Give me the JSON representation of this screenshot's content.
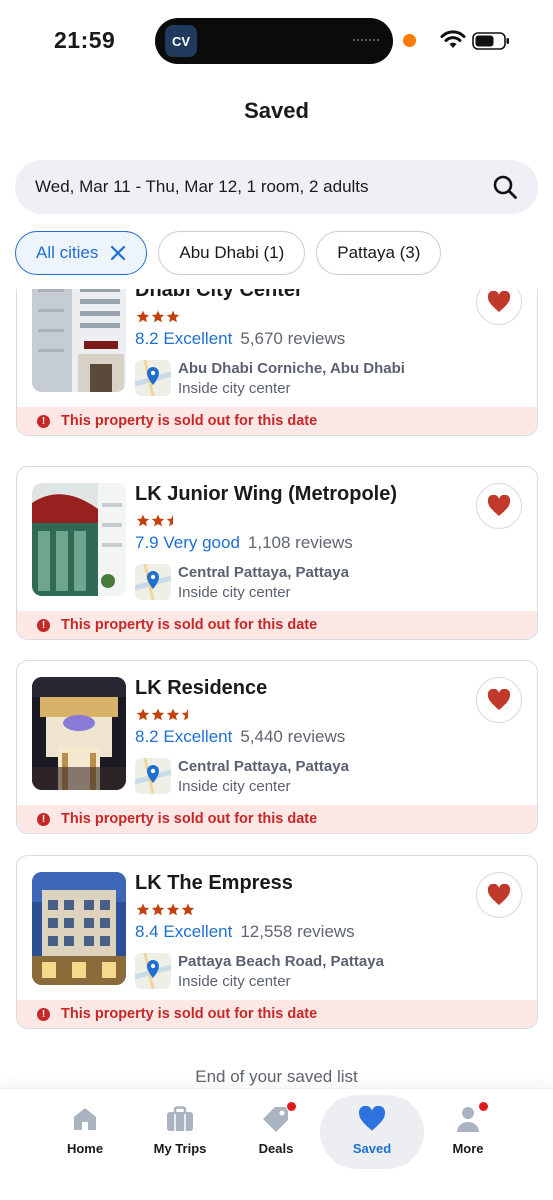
{
  "status_bar": {
    "time": "21:59",
    "island_app": "CV"
  },
  "header": {
    "title": "Saved"
  },
  "search": {
    "text": "Wed, Mar 11 - Thu, Mar 12, 1 room, 2 adults"
  },
  "filters": [
    {
      "label": "All cities",
      "active": true
    },
    {
      "label": "Abu Dhabi (1)",
      "active": false
    },
    {
      "label": "Pattaya (3)",
      "active": false
    }
  ],
  "hotels": [
    {
      "name": "Dhabi City Center",
      "stars": 3,
      "rating": "8.2 Excellent",
      "reviews": "5,670 reviews",
      "location": "Abu Dhabi Corniche, Abu Dhabi",
      "location_sub": "Inside city center",
      "status": "This property is sold out for this date"
    },
    {
      "name": "LK Junior Wing (Metropole)",
      "stars": 2.5,
      "rating": "7.9 Very good",
      "reviews": "1,108 reviews",
      "location": "Central Pattaya, Pattaya",
      "location_sub": "Inside city center",
      "status": "This property is sold out for this date"
    },
    {
      "name": "LK Residence",
      "stars": 3.5,
      "rating": "8.2 Excellent",
      "reviews": "5,440 reviews",
      "location": "Central Pattaya, Pattaya",
      "location_sub": "Inside city center",
      "status": "This property is sold out for this date"
    },
    {
      "name": "LK The Empress",
      "stars": 4,
      "rating": "8.4 Excellent",
      "reviews": "12,558 reviews",
      "location": "Pattaya Beach Road, Pattaya",
      "location_sub": "Inside city center",
      "status": "This property is sold out for this date"
    }
  ],
  "end_text": "End of your saved list",
  "tabs": [
    {
      "label": "Home",
      "icon": "home-icon"
    },
    {
      "label": "My Trips",
      "icon": "suitcase-icon"
    },
    {
      "label": "Deals",
      "icon": "tag-icon",
      "badge": true
    },
    {
      "label": "Saved",
      "icon": "heart-icon",
      "active": true
    },
    {
      "label": "More",
      "icon": "person-icon",
      "badge": true
    }
  ],
  "colors": {
    "accent": "#1f6fd1",
    "star": "#c2410c",
    "heart": "#c0392b",
    "alert": "#c62828",
    "alert_bg": "#fde8e6"
  }
}
